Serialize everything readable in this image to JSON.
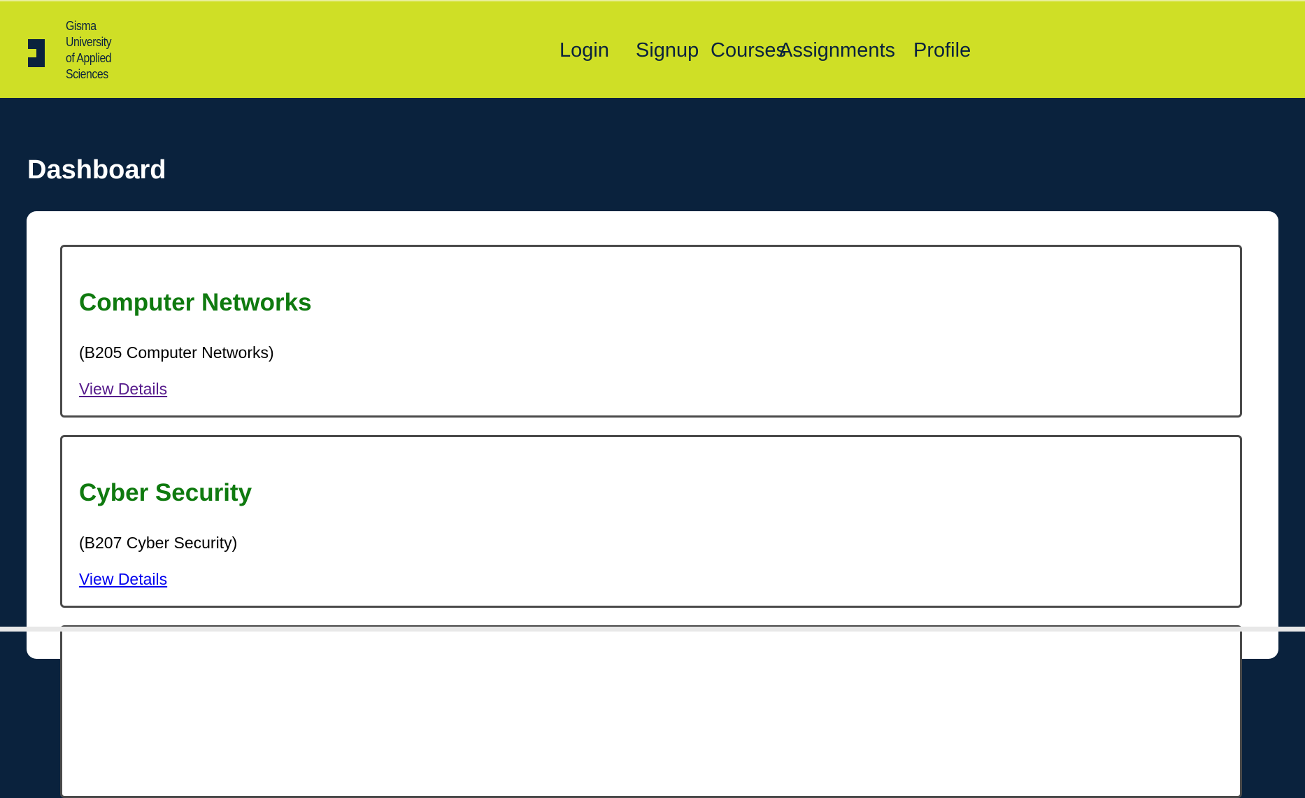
{
  "header": {
    "logo_lines": [
      "Gisma",
      "University",
      "of Applied",
      "Sciences"
    ],
    "nav": {
      "login": "Login",
      "signup": "Signup",
      "courses": "Courses",
      "assignments": "Assignments",
      "profile": "Profile"
    }
  },
  "main": {
    "title": "Dashboard",
    "courses": [
      {
        "name": "Computer Networks",
        "code": "(B205 Computer Networks)",
        "link": "View Details",
        "link_state": "visited"
      },
      {
        "name": "Cyber Security",
        "code": "(B207 Cyber Security)",
        "link": "View Details",
        "link_state": "unvisited"
      }
    ]
  },
  "colors": {
    "header_bg": "#cfdf26",
    "page_bg": "#0a223d",
    "course_title": "#0f7a0f",
    "link_visited": "#551a8b",
    "link_unvisited": "#0000ee"
  },
  "icons": {
    "logo": "gisma-logo-icon"
  }
}
